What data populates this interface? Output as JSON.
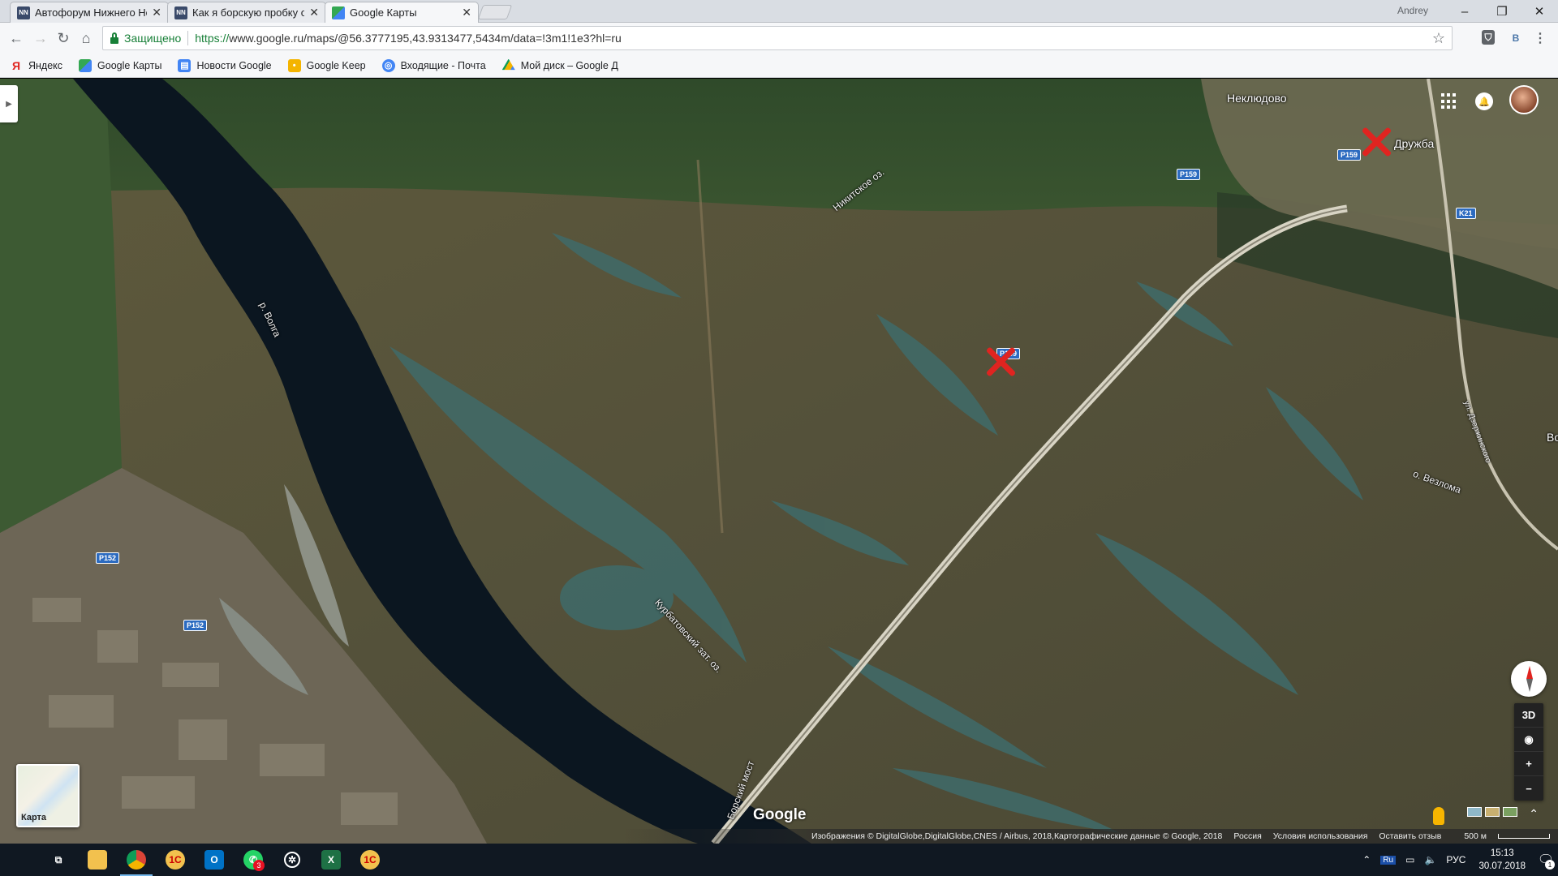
{
  "browser": {
    "tabs": [
      {
        "label": "Автофорум Нижнего Но",
        "favicon": "NN",
        "active": false
      },
      {
        "label": "Как я борскую пробку о",
        "favicon": "NN",
        "active": false
      },
      {
        "label": "Google Карты",
        "favicon": "maps",
        "active": true
      }
    ],
    "user": "Andrey",
    "secure_label": "Защищено",
    "url_scheme": "https://",
    "url_rest": "www.google.ru/maps/@56.3777195,43.9313477,5434m/data=!3m1!1e3?hl=ru",
    "bookmarks": [
      {
        "label": "Яндекс",
        "icon": "yandex-icon",
        "color": "#e02420"
      },
      {
        "label": "Google Карты",
        "icon": "maps-icon",
        "color": "#34a853"
      },
      {
        "label": "Новости Google",
        "icon": "news-icon",
        "color": "#4285f4"
      },
      {
        "label": "Google Keep",
        "icon": "keep-icon",
        "color": "#f4b400"
      },
      {
        "label": "Входящие - Почта",
        "icon": "inbox-icon",
        "color": "#4285f4"
      },
      {
        "label": "Мой диск – Google Д",
        "icon": "drive-icon",
        "color": "#0f9d58"
      }
    ]
  },
  "map": {
    "places": [
      {
        "label": "Неклюдово"
      },
      {
        "label": "Дружба"
      }
    ],
    "water_labels": [
      {
        "label": "р. Волга"
      },
      {
        "label": "Никитское оз."
      },
      {
        "label": "Курбатовский зат. оз."
      },
      {
        "label": "о. Везлома"
      }
    ],
    "road_labels": {
      "bridge": "Борский мост",
      "street": "ул. Дзержинского"
    },
    "shields": [
      "P159",
      "P159",
      "P159",
      "K21",
      "P152",
      "P152"
    ],
    "edge_label": "Во",
    "minimap_label": "Карта",
    "google_logo": "Google",
    "controls": {
      "tilt": "3D",
      "zoom_in": "+",
      "zoom_out": "−"
    },
    "attribution": "Изображения © DigitalGlobe,DigitalGlobe,CNES / Airbus, 2018,Картографические данные © Google, 2018",
    "footer_links": [
      "Россия",
      "Условия использования",
      "Оставить отзыв"
    ],
    "scale": "500 м"
  },
  "taskbar": {
    "lang_badge": "Ru",
    "lang": "РУС",
    "time": "15:13",
    "date": "30.07.2018",
    "whatsapp_badge": "3",
    "notif_count": "1"
  },
  "colors": {
    "marker": "#e02420",
    "secure": "#188038",
    "shield": "#2c6bc0"
  }
}
